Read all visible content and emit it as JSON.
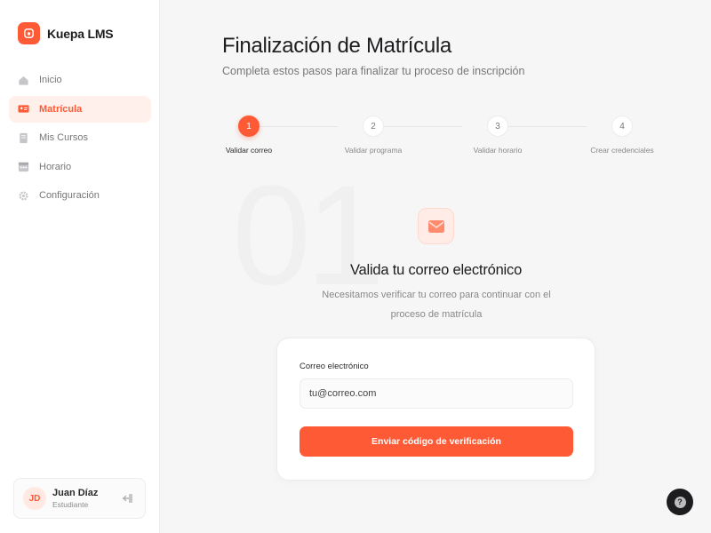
{
  "sidebar": {
    "brand": {
      "name": "Kuepa LMS",
      "icon": "lms-logo-icon"
    },
    "items": [
      {
        "label": "Inicio",
        "icon": "home-icon",
        "active": false
      },
      {
        "label": "Matrícula",
        "icon": "id-card-icon",
        "active": true
      },
      {
        "label": "Mis Cursos",
        "icon": "book-icon",
        "active": false
      },
      {
        "label": "Horario",
        "icon": "calendar-icon",
        "active": false
      },
      {
        "label": "Configuración",
        "icon": "gear-icon",
        "active": false
      }
    ],
    "user": {
      "initials": "JD",
      "name": "Juan Díaz",
      "role": "Estudiante",
      "logout_icon": "logout-icon"
    }
  },
  "main": {
    "title": "Finalización de Matrícula",
    "subtitle": "Completa estos pasos para finalizar tu proceso de inscripción",
    "steps": [
      {
        "number": "1",
        "label": "Validar correo",
        "active": true
      },
      {
        "number": "2",
        "label": "Validar programa",
        "active": false
      },
      {
        "number": "3",
        "label": "Validar horario",
        "active": false
      },
      {
        "number": "4",
        "label": "Crear credenciales",
        "active": false
      }
    ],
    "step_background_number": "01",
    "hero": {
      "icon": "mail-icon",
      "title": "Valida tu correo electrónico",
      "description": "Necesitamos verificar tu correo para continuar con el proceso de matrícula"
    },
    "form": {
      "email_label": "Correo electrónico",
      "email_value": "",
      "email_placeholder": "tu@correo.com",
      "submit_label": "Enviar código de verificación"
    }
  },
  "help": {
    "icon": "help-icon",
    "glyph": "?"
  },
  "colors": {
    "accent": "#ff5a36",
    "accent_soft": "#fff0eb",
    "dark": "#1d1d1f"
  }
}
